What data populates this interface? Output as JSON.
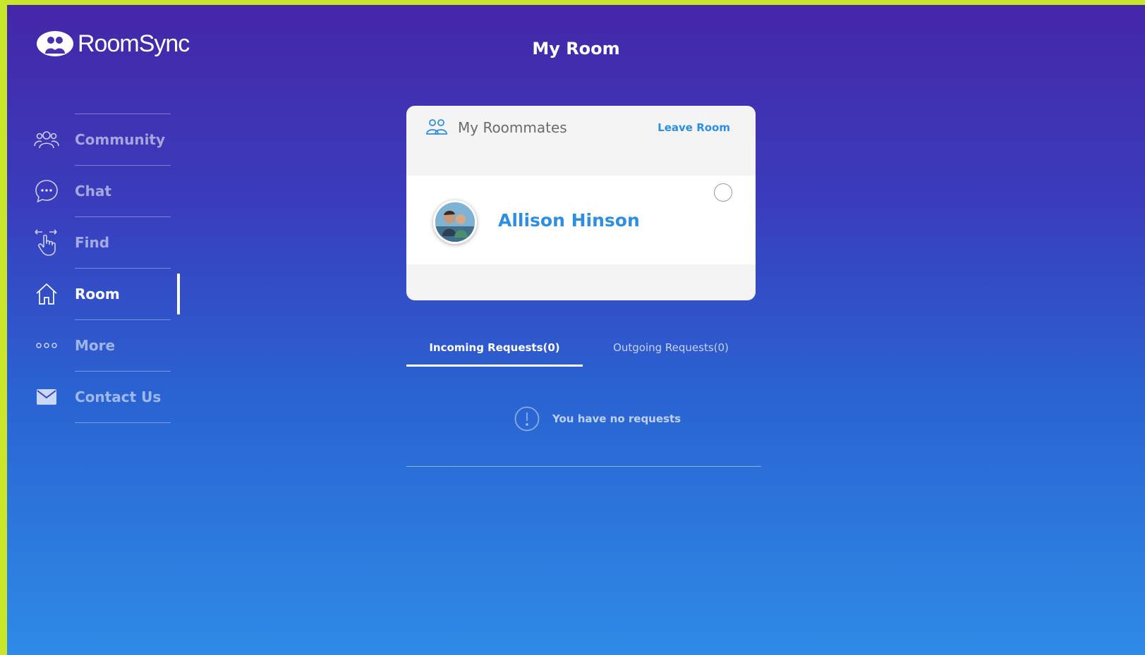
{
  "app": {
    "brand": "RoomSync",
    "page_title": "My Room"
  },
  "sidebar": {
    "items": [
      {
        "label": "Community",
        "icon": "community-icon",
        "active": false
      },
      {
        "label": "Chat",
        "icon": "chat-icon",
        "active": false
      },
      {
        "label": "Find",
        "icon": "swipe-hand-icon",
        "active": false
      },
      {
        "label": "Room",
        "icon": "home-icon",
        "active": true
      },
      {
        "label": "More",
        "icon": "more-dots-icon",
        "active": false
      },
      {
        "label": "Contact Us",
        "icon": "mail-icon",
        "active": false
      }
    ]
  },
  "roommates_card": {
    "title": "My Roommates",
    "leave_label": "Leave Room",
    "roommates": [
      {
        "name": "Allison Hinson"
      }
    ]
  },
  "requests": {
    "tabs": [
      {
        "label": "Incoming Requests(0)",
        "active": true
      },
      {
        "label": "Outgoing Requests(0)",
        "active": false
      }
    ],
    "empty_message": "You have no requests"
  },
  "colors": {
    "accent": "#2d8fe0",
    "frame": "#c8e52b",
    "gradient_top": "#4527a8",
    "gradient_bottom": "#2e8be6"
  }
}
